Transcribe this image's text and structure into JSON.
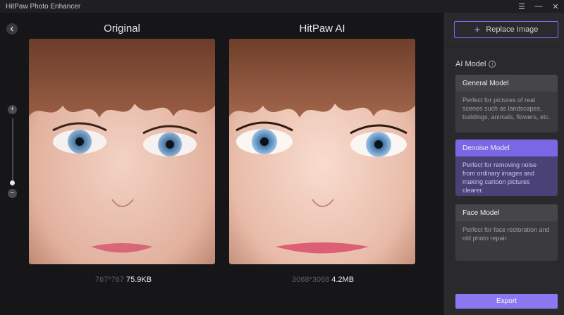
{
  "window": {
    "title": "HitPaw Photo Enhancer",
    "menu_glyph": "☰",
    "minimize_glyph": "—",
    "close_glyph": "✕"
  },
  "canvas": {
    "back_icon": "chevron-left-icon",
    "original": {
      "title": "Original",
      "resolution": "767*767",
      "size": "75.9KB"
    },
    "enhanced": {
      "title": "HitPaw AI",
      "resolution": "3068*3068",
      "size": "4.2MB"
    },
    "zoom": {
      "plus": "+",
      "minus": "−",
      "level": 0.08
    }
  },
  "sidebar": {
    "replace_label": "Replace Image",
    "ai_model_label": "AI Model",
    "models": [
      {
        "title": "General Model",
        "description": "Perfect for pictures of real scenes such as landscapes, buildings, animals, flowers, etc.",
        "selected": false
      },
      {
        "title": "Denoise Model",
        "description": "Perfect for removing noise from ordinary images and making cartoon pictures clearer.",
        "selected": true
      },
      {
        "title": "Face Model",
        "description": "Perfect for face restoration and old photo repair.",
        "selected": false
      }
    ],
    "export_label": "Export"
  },
  "colors": {
    "accent": "#7a67e6",
    "export": "#8b78f0",
    "background": "#161618",
    "sidebar": "#2a2a2d"
  }
}
